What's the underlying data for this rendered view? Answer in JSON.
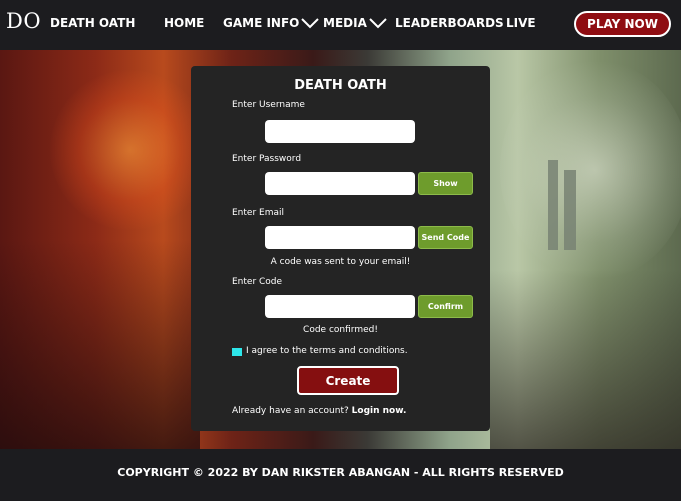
{
  "nav": {
    "logo": "DO",
    "brand": "DEATH OATH",
    "items": [
      {
        "label": "HOME"
      },
      {
        "label": "GAME INFO"
      },
      {
        "label": "MEDIA"
      },
      {
        "label": "LEADERBOARDS"
      },
      {
        "label": "LIVE"
      }
    ],
    "play_label": "PLAY NOW"
  },
  "form": {
    "title": "DEATH OATH",
    "username": {
      "label": "Enter Username",
      "value": ""
    },
    "password": {
      "label": "Enter Password",
      "value": "",
      "show_label": "Show"
    },
    "email": {
      "label": "Enter Email",
      "value": "",
      "send_label": "Send Code",
      "note": "A code was sent to your email!"
    },
    "code": {
      "label": "Enter Code",
      "value": "",
      "confirm_label": "Confirm",
      "note": "Code confirmed!"
    },
    "terms_label": "I agree to the terms and conditions.",
    "terms_checked": true,
    "create_label": "Create",
    "login_prompt": "Already have an account?",
    "login_link": "Login now."
  },
  "footer": {
    "copyright": "COPYRIGHT © 2022 BY DAN RIKSTER ABANGAN - ALL RIGHTS RESERVED"
  },
  "colors": {
    "nav_bg": "#1c1c1f",
    "play_button": "#8f0d12",
    "panel_bg": "#242424",
    "green_button": "#6e9c2c",
    "create_button": "#850f10",
    "checkbox": "#2ee6ea"
  }
}
